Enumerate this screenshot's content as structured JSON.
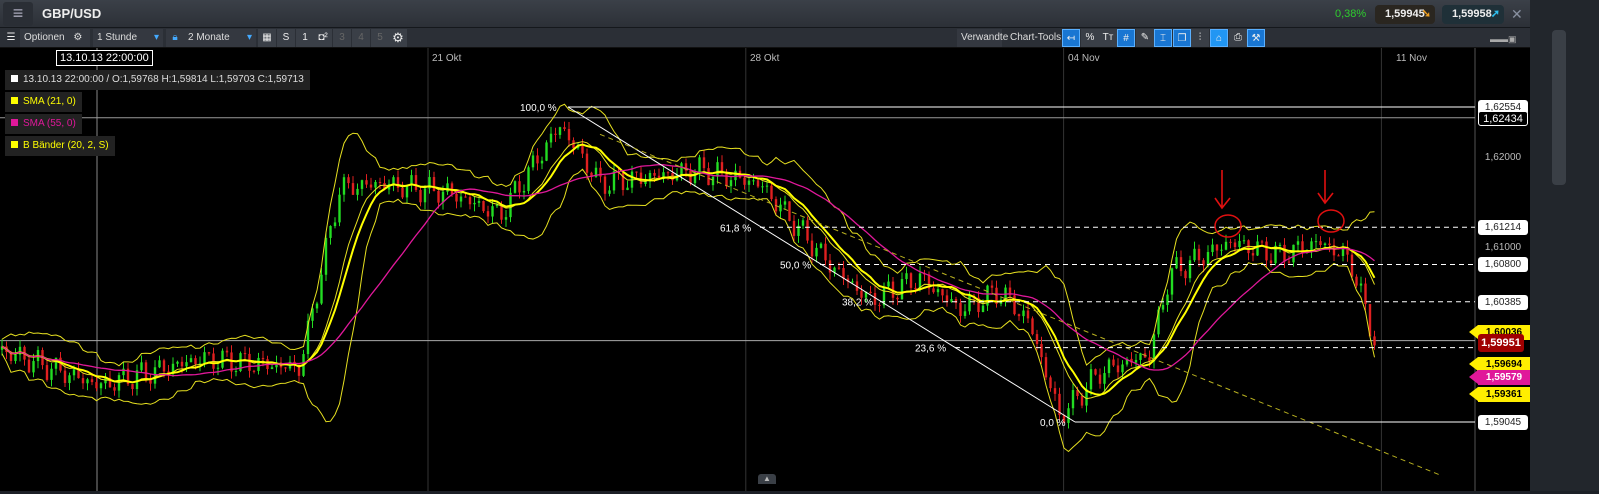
{
  "header": {
    "menu_icon": "hamburger-icon",
    "title": "GBP/USD",
    "change_pct": "0,38%",
    "bid": "1,59945",
    "ask": "1,59958",
    "close_icon": "close-icon"
  },
  "toolbar": {
    "optionen": "Optionen",
    "interval": "1 Stunde",
    "range": "2 Monate",
    "s": "S",
    "b1": "1",
    "b3": "3",
    "b4": "4",
    "b5": "5",
    "verwandte": "Verwandte",
    "chart_tools": "Chart-Tools",
    "pct_btn": "%",
    "text_btn": "Tт"
  },
  "crosshair": {
    "date_label": "13.10.13 22:00:00"
  },
  "legend": {
    "ohlc": "13.10.13 22:00:00 / O:1,59768  H:1,59814  L:1,59703  C:1,59713",
    "sma21": "SMA (21, 0)",
    "sma55": "SMA (55, 0)",
    "bb": "B Bänder (20, 2, S)"
  },
  "colors": {
    "up": "#22dd22",
    "down": "#e02020",
    "sma21": "#ffff00",
    "sma55": "#e0189a",
    "bb": "#e6e020"
  },
  "chart_data": {
    "type": "candlestick",
    "x_ticks": [
      "21 Okt",
      "28 Okt",
      "04 Nov",
      "11 Nov"
    ],
    "x_tick_days": [
      8,
      15,
      22,
      29
    ],
    "y_ticks": [
      "1,62000",
      "1,61000"
    ],
    "y_tick_values": [
      1.62,
      1.61
    ],
    "price_path": [
      [
        -1.43,
        1.5985
      ],
      [
        0.78,
        1.5945
      ],
      [
        3.0,
        1.5975
      ],
      [
        5.18,
        1.5965
      ],
      [
        6.06,
        1.6165
      ],
      [
        6.94,
        1.617
      ],
      [
        8.48,
        1.616
      ],
      [
        9.59,
        1.6135
      ],
      [
        10.91,
        1.6235
      ],
      [
        11.79,
        1.617
      ],
      [
        13.99,
        1.6185
      ],
      [
        15.31,
        1.617
      ],
      [
        16.85,
        1.608
      ],
      [
        17.74,
        1.604
      ],
      [
        18.84,
        1.6065
      ],
      [
        19.72,
        1.603
      ],
      [
        20.6,
        1.605
      ],
      [
        21.26,
        1.6015
      ],
      [
        21.92,
        1.591
      ],
      [
        22.8,
        1.596
      ],
      [
        23.9,
        1.598
      ],
      [
        24.34,
        1.607
      ],
      [
        25.67,
        1.6105
      ],
      [
        26.77,
        1.609
      ],
      [
        27.65,
        1.6105
      ],
      [
        28.31,
        1.6085
      ],
      [
        28.86,
        1.5995
      ]
    ],
    "fibonacci": {
      "high": 1.62554,
      "low": 1.59045,
      "levels": [
        {
          "label": "100,0 %",
          "value": 1.62554
        },
        {
          "label": "61,8 %",
          "value": 1.61214
        },
        {
          "label": "50,0 %",
          "value": 1.608
        },
        {
          "label": "38,2 %",
          "value": 1.60385
        },
        {
          "label": "23,6 %",
          "value": 1.59873
        },
        {
          "label": "0,0 %",
          "value": 1.59045
        }
      ]
    },
    "price_labels": [
      {
        "text": "1,62554",
        "value": 1.62554,
        "style": "white"
      },
      {
        "text": "1,62434",
        "value": 1.62434,
        "style": "boxed"
      },
      {
        "text": "1,62000",
        "value": 1.62,
        "style": "plain"
      },
      {
        "text": "1,61214",
        "value": 1.61214,
        "style": "white"
      },
      {
        "text": "1,61000",
        "value": 1.61,
        "style": "plain"
      },
      {
        "text": "1,60800",
        "value": 1.608,
        "style": "white"
      },
      {
        "text": "1,60385",
        "value": 1.60385,
        "style": "white"
      }
    ],
    "tags": [
      {
        "text": "1,60036",
        "value": 1.6005,
        "color": "#ffee00"
      },
      {
        "text": "1,59694",
        "value": 1.59694,
        "color": "#ffee00"
      },
      {
        "text": "1,59579",
        "value": 1.5955,
        "color": "#e0189a"
      },
      {
        "text": "1,59361",
        "value": 1.59361,
        "color": "#ffee00"
      },
      {
        "text": "1,59951",
        "value": 1.59951,
        "color": "#a00000"
      },
      {
        "text": "1,59045",
        "value": 1.59045,
        "color": "#ffffff"
      }
    ]
  }
}
